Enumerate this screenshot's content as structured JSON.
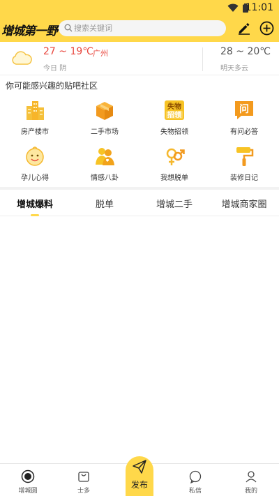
{
  "status_bar": {
    "time": "11:01"
  },
  "header": {
    "logo_text": "增城第一野",
    "search_placeholder": "搜索关键词"
  },
  "weather": {
    "today_temp": "27 ~ 19℃",
    "city": "广州",
    "today_label": "今日 阴",
    "tomorrow_temp": "28 ~ 20℃",
    "tomorrow_label": "明天多云"
  },
  "communities": {
    "title": "你可能感兴趣的贴吧社区",
    "items": [
      {
        "label": "房产楼市",
        "icon": "buildings-icon"
      },
      {
        "label": "二手市场",
        "icon": "box-icon"
      },
      {
        "label": "失物招领",
        "icon": "lost-found-icon",
        "badge_line1": "失物",
        "badge_line2": "招领"
      },
      {
        "label": "有问必答",
        "icon": "question-icon",
        "badge": "问"
      },
      {
        "label": "孕儿心得",
        "icon": "baby-icon"
      },
      {
        "label": "情感八卦",
        "icon": "couple-icon"
      },
      {
        "label": "我想脱单",
        "icon": "gender-icon"
      },
      {
        "label": "装修日记",
        "icon": "paint-roller-icon"
      }
    ]
  },
  "tabs": [
    {
      "label": "增城爆料",
      "active": true
    },
    {
      "label": "脱单",
      "active": false
    },
    {
      "label": "增城二手",
      "active": false
    },
    {
      "label": "增城商家圈",
      "active": false
    }
  ],
  "bottom_nav": {
    "items": [
      {
        "label": "增城圆",
        "icon": "home-circle-icon"
      },
      {
        "label": "士多",
        "icon": "shop-bag-icon"
      },
      {
        "label": "私信",
        "icon": "message-icon"
      },
      {
        "label": "我的",
        "icon": "profile-icon"
      }
    ],
    "publish_label": "发布"
  },
  "colors": {
    "accent": "#ffd84a",
    "temp_red": "#e8453c",
    "icon_orange": "#f5a623"
  }
}
